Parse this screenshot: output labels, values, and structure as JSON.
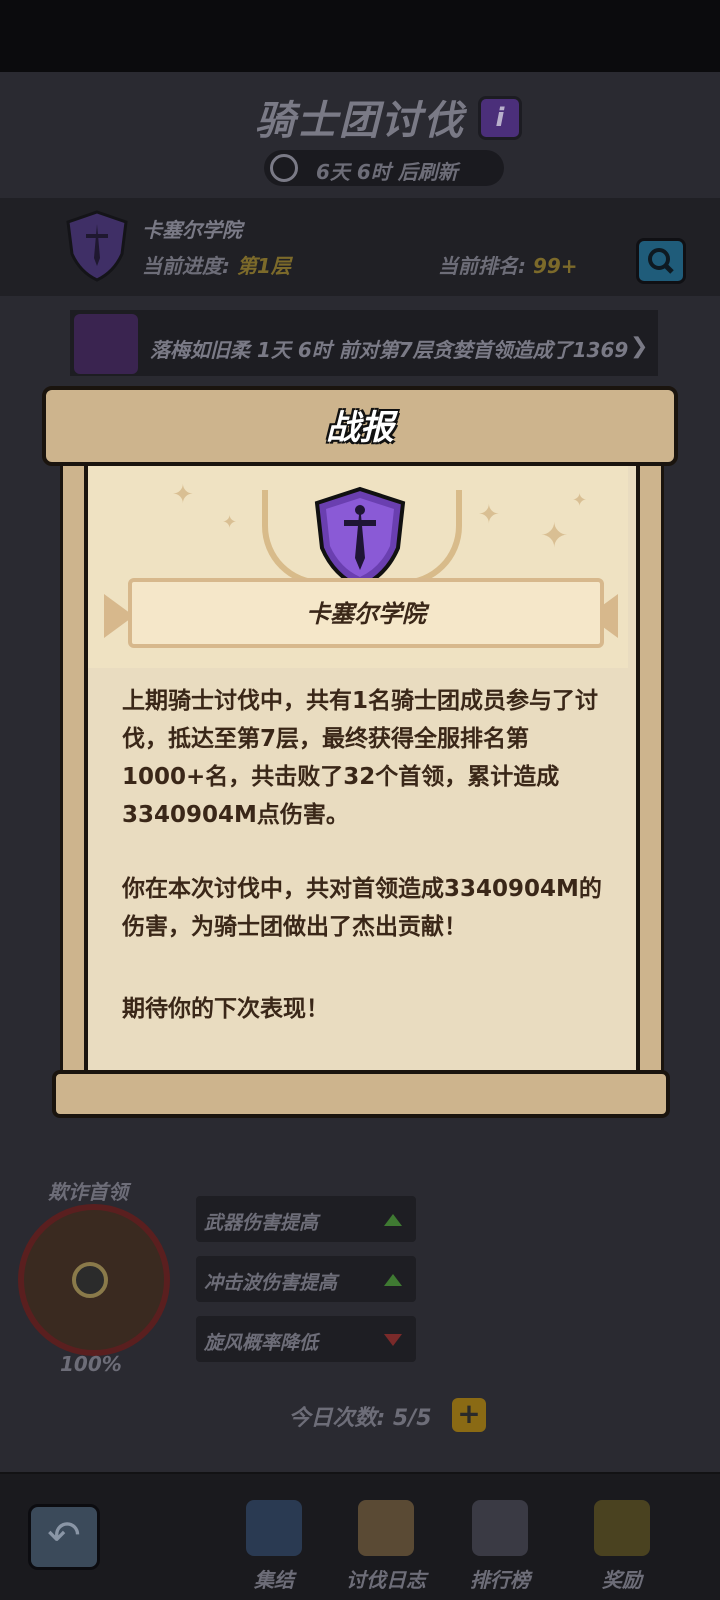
{
  "header": {
    "title": "骑士团讨伐",
    "info_icon": "i",
    "timer_text": "6天 6时 后刷新"
  },
  "guild": {
    "name": "卡塞尔学院",
    "progress_label": "当前进度: ",
    "progress_value": "第1层",
    "rank_label": "当前排名: ",
    "rank_value": "99+"
  },
  "news": {
    "text": "落梅如旧柔 1天 6时 前对第7层贪婪首领造成了1369"
  },
  "modal": {
    "title": "战报",
    "guild_name": "卡塞尔学院",
    "para1": "上期骑士讨伐中，共有1名骑士团成员参与了讨伐，抵达至第7层，最终获得全服排名第1000+名，共击败了32个首领，累计造成3340904M点伤害。",
    "para2": "你在本次讨伐中，共对首领造成3340904M的伤害，为骑士团做出了杰出贡献！",
    "para3": "期待你的下次表现！"
  },
  "boss": {
    "label": "欺诈首领",
    "percent": "100%",
    "buffs": [
      {
        "text": "武器伤害提高",
        "dir": "up"
      },
      {
        "text": "冲击波伤害提高",
        "dir": "up"
      },
      {
        "text": "旋风概率降低",
        "dir": "down"
      }
    ]
  },
  "attempts": {
    "text": "今日次数: 5/5",
    "plus": "+"
  },
  "nav": {
    "items": [
      {
        "label": "集结"
      },
      {
        "label": "讨伐日志"
      },
      {
        "label": "排行榜"
      },
      {
        "label": "奖励"
      }
    ]
  },
  "colors": {
    "accent_gold": "#7c6a2a",
    "scroll_paper": "#e9dcc0",
    "crest_purple": "#6a3fb0"
  }
}
